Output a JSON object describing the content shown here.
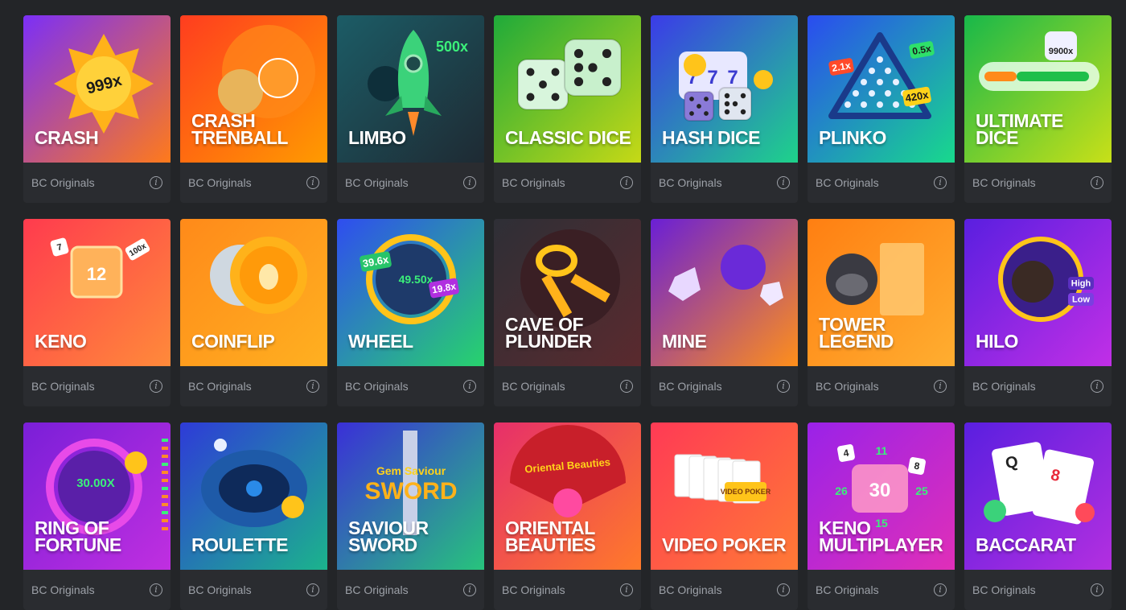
{
  "provider_label": "BC Originals",
  "games": [
    {
      "title": "CRASH",
      "bg": [
        "#7b2ff7",
        "#ff7a1a"
      ],
      "art": "crash",
      "badge": "999x"
    },
    {
      "title": "CRASH\nTRENBALL",
      "bg": [
        "#ff3d1f",
        "#ff9b00"
      ],
      "art": "trenball"
    },
    {
      "title": "LIMBO",
      "bg": [
        "#1c5c66",
        "#1e2a33"
      ],
      "art": "limbo",
      "badge": "500x"
    },
    {
      "title": "CLASSIC DICE",
      "bg": [
        "#1faa3a",
        "#c6d916"
      ],
      "art": "dice"
    },
    {
      "title": "HASH DICE",
      "bg": [
        "#3b3be8",
        "#1ed38a"
      ],
      "art": "hashdice"
    },
    {
      "title": "PLINKO",
      "bg": [
        "#2a4cf0",
        "#18d98c"
      ],
      "art": "plinko",
      "badges": [
        "2.1x",
        "0.5x",
        "420x"
      ]
    },
    {
      "title": "ULTIMATE\nDICE",
      "bg": [
        "#18b84a",
        "#c8e018"
      ],
      "art": "ultimate",
      "badge": "9900x"
    },
    {
      "title": "KENO",
      "bg": [
        "#ff3b4e",
        "#ff8a3a"
      ],
      "art": "keno",
      "badge": "12",
      "badges": [
        "7",
        "100x"
      ]
    },
    {
      "title": "COINFLIP",
      "bg": [
        "#ff8a1a",
        "#ffb020"
      ],
      "art": "coinflip"
    },
    {
      "title": "WHEEL",
      "bg": [
        "#2f4df0",
        "#27d36c"
      ],
      "art": "wheel",
      "badge": "49.50x",
      "badges": [
        "39.6x",
        "19.8x"
      ]
    },
    {
      "title": "CAVE OF\nPLUNDER",
      "bg": [
        "#2e2f36",
        "#5a2a2e"
      ],
      "art": "cave"
    },
    {
      "title": "MINE",
      "bg": [
        "#6a1fd6",
        "#ff8f1a"
      ],
      "art": "mine"
    },
    {
      "title": "TOWER\nLEGEND",
      "bg": [
        "#ff7f12",
        "#ffae30"
      ],
      "art": "tower"
    },
    {
      "title": "HILO",
      "bg": [
        "#5a1fe0",
        "#c12fe6"
      ],
      "art": "hilo",
      "badges": [
        "High",
        "Low"
      ]
    },
    {
      "title": "RING OF\nFORTUNE",
      "bg": [
        "#7a1fd8",
        "#c02fe0"
      ],
      "art": "ring",
      "badge": "30.00X"
    },
    {
      "title": "ROULETTE",
      "bg": [
        "#2e3bd8",
        "#1bb48c"
      ],
      "art": "roulette"
    },
    {
      "title": "SAVIOUR\nSWORD",
      "bg": [
        "#3a2fd8",
        "#27c47c"
      ],
      "art": "sword",
      "badge": "SWORD",
      "badges": [
        "Gem Saviour"
      ]
    },
    {
      "title": "ORIENTAL\nBEAUTIES",
      "bg": [
        "#e62f6a",
        "#ff7a2a"
      ],
      "art": "oriental",
      "badges": [
        "Oriental Beauties"
      ]
    },
    {
      "title": "VIDEO POKER",
      "bg": [
        "#ff3a55",
        "#ff7a35"
      ],
      "art": "poker",
      "badges": [
        "VIDEO POKER"
      ]
    },
    {
      "title": "KENO\nMULTIPLAYER",
      "bg": [
        "#9a22e8",
        "#e02fb8"
      ],
      "art": "kenomp",
      "badge": "30",
      "badges": [
        "11",
        "26",
        "25",
        "15",
        "8",
        "4"
      ]
    },
    {
      "title": "BACCARAT",
      "bg": [
        "#5a1fe0",
        "#b32fe0"
      ],
      "art": "baccarat",
      "badges": [
        "Q",
        "8"
      ]
    }
  ]
}
